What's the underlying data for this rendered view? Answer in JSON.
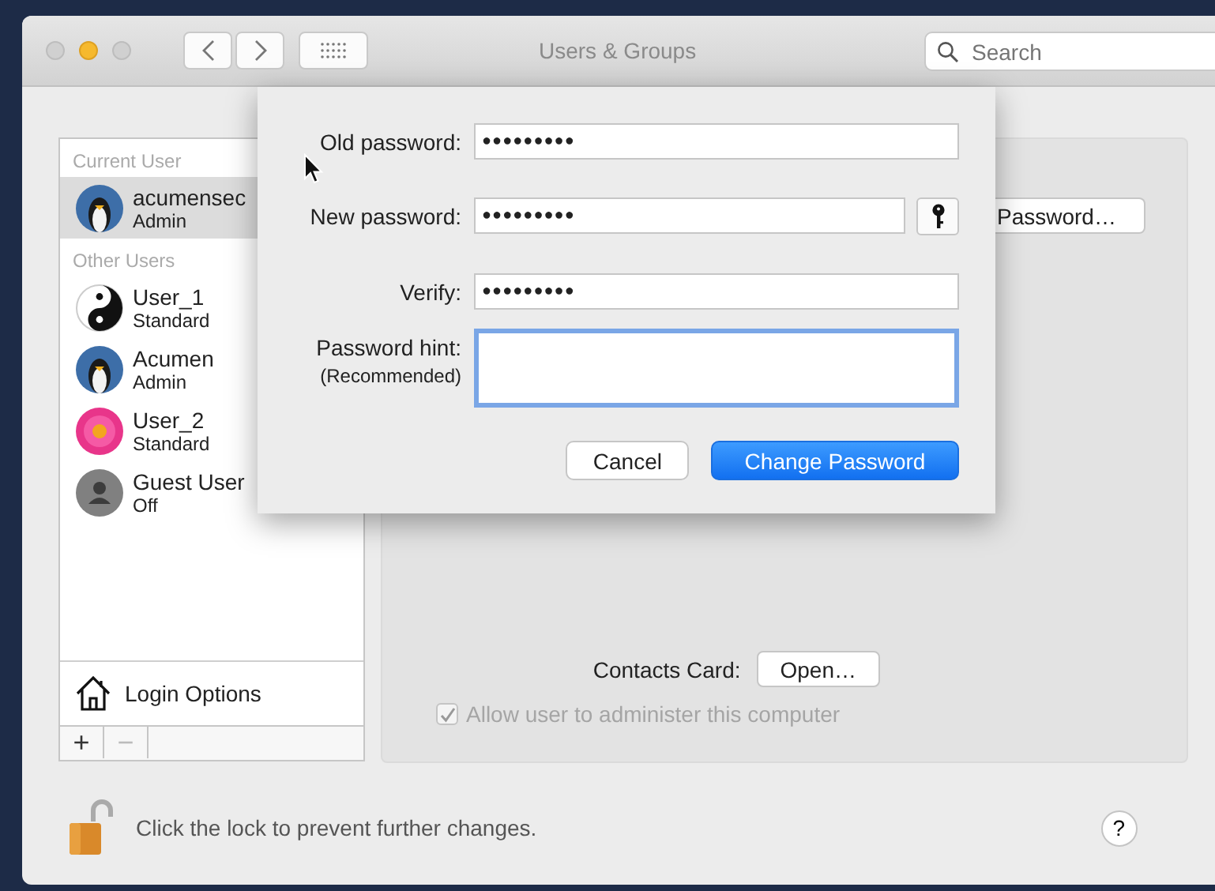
{
  "window": {
    "title": "Users & Groups",
    "search": {
      "placeholder": "Search"
    }
  },
  "sidebar": {
    "sections": [
      {
        "heading": "Current User",
        "users": [
          {
            "name": "acumensec",
            "role": "Admin",
            "kind": "penguin",
            "selected": true
          }
        ]
      },
      {
        "heading": "Other Users",
        "users": [
          {
            "name": "User_1",
            "role": "Standard",
            "kind": "yinyang",
            "selected": false
          },
          {
            "name": "Acumen",
            "role": "Admin",
            "kind": "penguin",
            "selected": false
          },
          {
            "name": "User_2",
            "role": "Standard",
            "kind": "flower",
            "selected": false
          },
          {
            "name": "Guest User",
            "role": "Off",
            "kind": "guest",
            "selected": false
          }
        ]
      }
    ],
    "login_options": "Login Options",
    "buttons": [
      {
        "label": "+",
        "disabled": false
      },
      {
        "label": "−",
        "disabled": true
      }
    ]
  },
  "panel": {
    "password_button": "Password…",
    "contacts_label": "Contacts Card:",
    "contacts_button": "Open…",
    "admin_checkbox": {
      "label": "Allow user to administer this computer",
      "checked": true,
      "disabled": true
    }
  },
  "sheet": {
    "fields": [
      {
        "label": "Old password:",
        "value": "●●●●●●●●●",
        "kind": "password"
      },
      {
        "label": "New password:",
        "value": "●●●●●●●●●",
        "kind": "password-key"
      },
      {
        "label": "Verify:",
        "value": "●●●●●●●●●",
        "kind": "password"
      },
      {
        "label": "Password hint:",
        "sublabel": "(Recommended)",
        "kind": "textarea",
        "focused": true
      }
    ],
    "buttons": [
      {
        "label": "Cancel",
        "default": false
      },
      {
        "label": "Change Password",
        "default": true
      }
    ]
  },
  "footer": {
    "text": "Click the lock to prevent further changes.",
    "locked": false,
    "help": "?"
  }
}
